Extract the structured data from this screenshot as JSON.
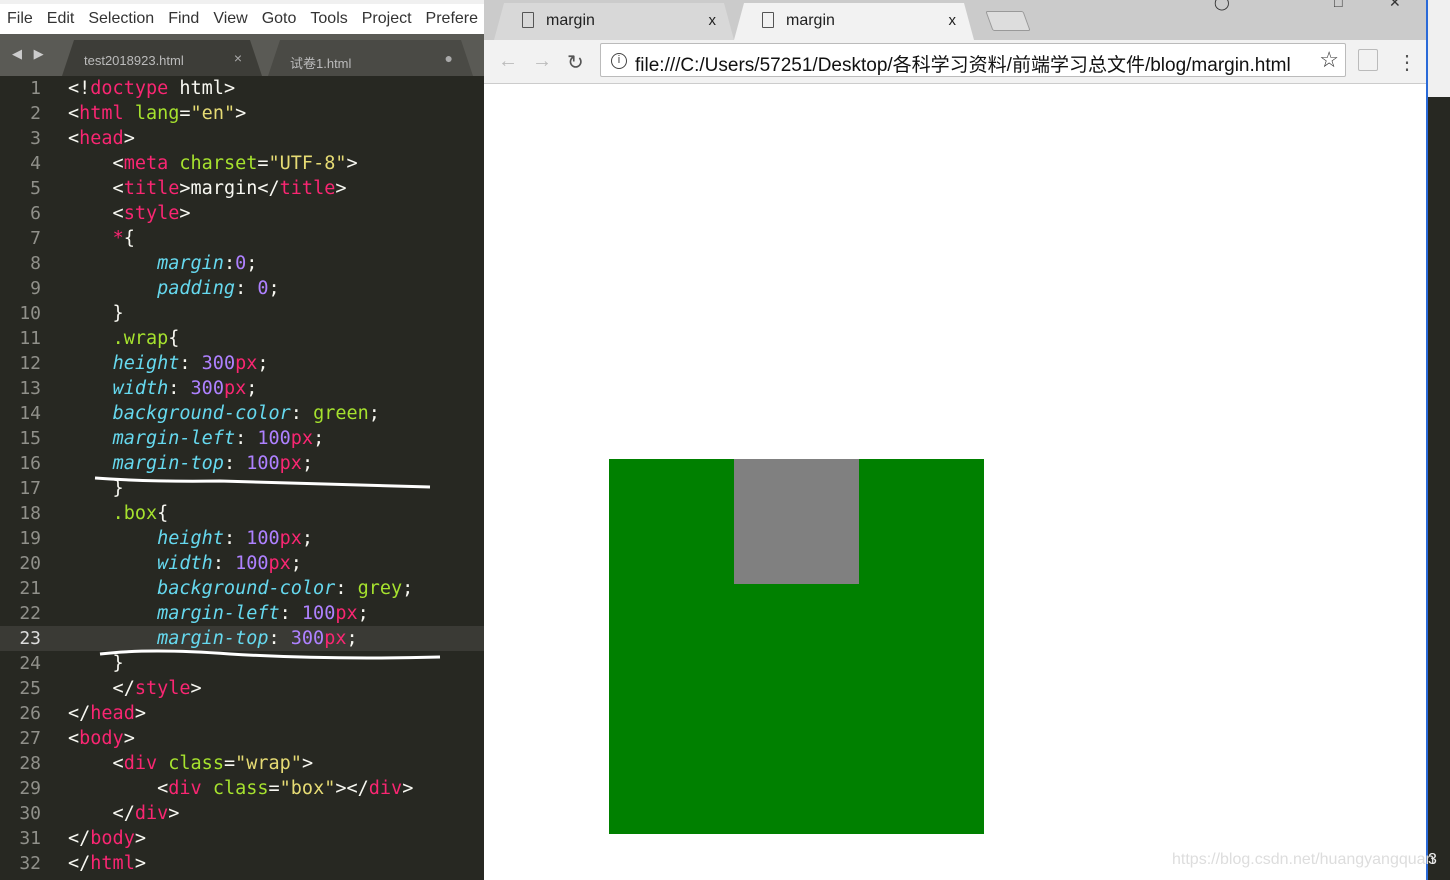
{
  "editor": {
    "menu": [
      "File",
      "Edit",
      "Selection",
      "Find",
      "View",
      "Goto",
      "Tools",
      "Project",
      "Prefere"
    ],
    "tabs": [
      {
        "label": "test2018923.html",
        "close": "×"
      },
      {
        "label": "试卷1.html",
        "close": "●"
      }
    ],
    "nav_arrows": "◀ ▶",
    "current_line": 23,
    "lines": [
      [
        [
          "p",
          "<!"
        ],
        [
          "t",
          "doctype"
        ],
        [
          "p",
          " html>"
        ]
      ],
      [
        [
          "p",
          "<"
        ],
        [
          "t",
          "html"
        ],
        [
          "p",
          " "
        ],
        [
          "a",
          "lang"
        ],
        [
          "p",
          "="
        ],
        [
          "s",
          "\"en\""
        ],
        [
          "p",
          ">"
        ]
      ],
      [
        [
          "p",
          "<"
        ],
        [
          "t",
          "head"
        ],
        [
          "p",
          ">"
        ]
      ],
      [
        [
          "p",
          "    <"
        ],
        [
          "t",
          "meta"
        ],
        [
          "p",
          " "
        ],
        [
          "a",
          "charset"
        ],
        [
          "p",
          "="
        ],
        [
          "s",
          "\"UTF-8\""
        ],
        [
          "p",
          ">"
        ]
      ],
      [
        [
          "p",
          "    <"
        ],
        [
          "t",
          "title"
        ],
        [
          "p",
          ">margin</"
        ],
        [
          "t",
          "title"
        ],
        [
          "p",
          ">"
        ]
      ],
      [
        [
          "p",
          "    <"
        ],
        [
          "t",
          "style"
        ],
        [
          "p",
          ">"
        ]
      ],
      [
        [
          "p",
          "    "
        ],
        [
          "t",
          "*"
        ],
        [
          "p",
          "{"
        ]
      ],
      [
        [
          "p",
          "        "
        ],
        [
          "k",
          "margin"
        ],
        [
          "p",
          ":"
        ],
        [
          "n",
          "0"
        ],
        [
          "p",
          ";"
        ]
      ],
      [
        [
          "p",
          "        "
        ],
        [
          "k",
          "padding"
        ],
        [
          "p",
          ": "
        ],
        [
          "n",
          "0"
        ],
        [
          "p",
          ";"
        ]
      ],
      [
        [
          "p",
          "    }"
        ]
      ],
      [
        [
          "p",
          "    "
        ],
        [
          "g",
          ".wrap"
        ],
        [
          "p",
          "{"
        ]
      ],
      [
        [
          "p",
          "    "
        ],
        [
          "k",
          "height"
        ],
        [
          "p",
          ": "
        ],
        [
          "n",
          "300"
        ],
        [
          "u",
          "px"
        ],
        [
          "p",
          ";"
        ]
      ],
      [
        [
          "p",
          "    "
        ],
        [
          "k",
          "width"
        ],
        [
          "p",
          ": "
        ],
        [
          "n",
          "300"
        ],
        [
          "u",
          "px"
        ],
        [
          "p",
          ";"
        ]
      ],
      [
        [
          "p",
          "    "
        ],
        [
          "k",
          "background-color"
        ],
        [
          "p",
          ": "
        ],
        [
          "g",
          "green"
        ],
        [
          "p",
          ";"
        ]
      ],
      [
        [
          "p",
          "    "
        ],
        [
          "k",
          "margin-left"
        ],
        [
          "p",
          ": "
        ],
        [
          "n",
          "100"
        ],
        [
          "u",
          "px"
        ],
        [
          "p",
          ";"
        ]
      ],
      [
        [
          "p",
          "    "
        ],
        [
          "k",
          "margin-top"
        ],
        [
          "p",
          ": "
        ],
        [
          "n",
          "100"
        ],
        [
          "u",
          "px"
        ],
        [
          "p",
          ";"
        ]
      ],
      [
        [
          "p",
          "    }"
        ]
      ],
      [
        [
          "p",
          "    "
        ],
        [
          "g",
          ".box"
        ],
        [
          "p",
          "{"
        ]
      ],
      [
        [
          "p",
          "        "
        ],
        [
          "k",
          "height"
        ],
        [
          "p",
          ": "
        ],
        [
          "n",
          "100"
        ],
        [
          "u",
          "px"
        ],
        [
          "p",
          ";"
        ]
      ],
      [
        [
          "p",
          "        "
        ],
        [
          "k",
          "width"
        ],
        [
          "p",
          ": "
        ],
        [
          "n",
          "100"
        ],
        [
          "u",
          "px"
        ],
        [
          "p",
          ";"
        ]
      ],
      [
        [
          "p",
          "        "
        ],
        [
          "k",
          "background-color"
        ],
        [
          "p",
          ": "
        ],
        [
          "g",
          "grey"
        ],
        [
          "p",
          ";"
        ]
      ],
      [
        [
          "p",
          "        "
        ],
        [
          "k",
          "margin-left"
        ],
        [
          "p",
          ": "
        ],
        [
          "n",
          "100"
        ],
        [
          "u",
          "px"
        ],
        [
          "p",
          ";"
        ]
      ],
      [
        [
          "p",
          "        "
        ],
        [
          "k",
          "margin-top"
        ],
        [
          "p",
          ": "
        ],
        [
          "n",
          "300"
        ],
        [
          "u",
          "px"
        ],
        [
          "p",
          ";"
        ]
      ],
      [
        [
          "p",
          "    }"
        ]
      ],
      [
        [
          "p",
          "    </"
        ],
        [
          "t",
          "style"
        ],
        [
          "p",
          ">"
        ]
      ],
      [
        [
          "p",
          "</"
        ],
        [
          "t",
          "head"
        ],
        [
          "p",
          ">"
        ]
      ],
      [
        [
          "p",
          "<"
        ],
        [
          "t",
          "body"
        ],
        [
          "p",
          ">"
        ]
      ],
      [
        [
          "p",
          "    <"
        ],
        [
          "t",
          "div"
        ],
        [
          "p",
          " "
        ],
        [
          "a",
          "class"
        ],
        [
          "p",
          "="
        ],
        [
          "s",
          "\"wrap\""
        ],
        [
          "p",
          ">"
        ]
      ],
      [
        [
          "p",
          "        <"
        ],
        [
          "t",
          "div"
        ],
        [
          "p",
          " "
        ],
        [
          "a",
          "class"
        ],
        [
          "p",
          "="
        ],
        [
          "s",
          "\"box\""
        ],
        [
          "p",
          "></"
        ],
        [
          "t",
          "div"
        ],
        [
          "p",
          ">"
        ]
      ],
      [
        [
          "p",
          "    </"
        ],
        [
          "t",
          "div"
        ],
        [
          "p",
          ">"
        ]
      ],
      [
        [
          "p",
          "</"
        ],
        [
          "t",
          "body"
        ],
        [
          "p",
          ">"
        ]
      ],
      [
        [
          "p",
          "</"
        ],
        [
          "t",
          "html"
        ],
        [
          "p",
          ">"
        ]
      ]
    ]
  },
  "browser": {
    "tabs": [
      {
        "label": "margin",
        "close": "x",
        "active": false
      },
      {
        "label": "margin",
        "close": "x",
        "active": true
      }
    ],
    "url": "file:///C:/Users/57251/Desktop/各科学习资料/前端学习总文件/blog/margin.html",
    "icons": {
      "back": "←",
      "forward": "→",
      "reload": "↻",
      "info": "i",
      "star": "☆",
      "menu": "⋮"
    },
    "content": {
      "wrap_color": "#008000",
      "box_color": "#808080"
    }
  },
  "watermark": "https://blog.csdn.net/huangyangquan",
  "watermark_tail": "3"
}
